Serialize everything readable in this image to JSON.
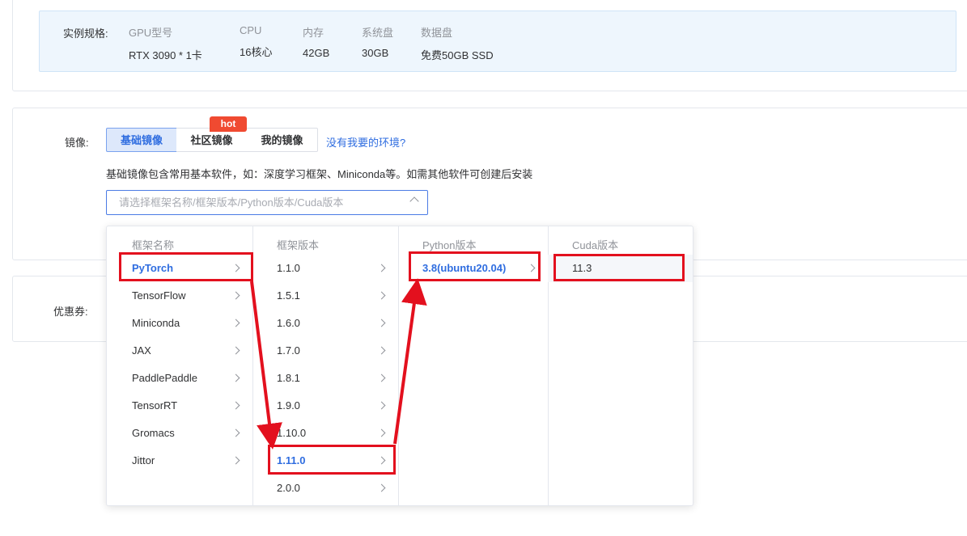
{
  "spec": {
    "label": "实例规格:",
    "columns": [
      {
        "header": "GPU型号",
        "value": "RTX 3090 * 1卡"
      },
      {
        "header": "CPU",
        "value": "16核心"
      },
      {
        "header": "内存",
        "value": "42GB"
      },
      {
        "header": "系统盘",
        "value": "30GB"
      },
      {
        "header": "数据盘",
        "value": "免费50GB SSD"
      }
    ]
  },
  "image": {
    "label": "镜像:",
    "tabs": [
      "基础镜像",
      "社区镜像",
      "我的镜像"
    ],
    "hot_badge": "hot",
    "help_link": "没有我要的环境?",
    "description": "基础镜像包含常用基本软件，如：深度学习框架、Miniconda等。如需其他软件可创建后安装",
    "select_placeholder": "请选择框架名称/框架版本/Python版本/Cuda版本"
  },
  "coupon": {
    "label": "优惠券:"
  },
  "cascader": {
    "frameworks": {
      "header": "框架名称",
      "items": [
        "PyTorch",
        "TensorFlow",
        "Miniconda",
        "JAX",
        "PaddlePaddle",
        "TensorRT",
        "Gromacs",
        "Jittor"
      ],
      "selected": "PyTorch"
    },
    "versions": {
      "header": "框架版本",
      "items": [
        "1.1.0",
        "1.5.1",
        "1.6.0",
        "1.7.0",
        "1.8.1",
        "1.9.0",
        "1.10.0",
        "1.11.0",
        "2.0.0"
      ],
      "selected": "1.11.0"
    },
    "python": {
      "header": "Python版本",
      "items": [
        "3.8(ubuntu20.04)"
      ],
      "selected": "3.8(ubuntu20.04)"
    },
    "cuda": {
      "header": "Cuda版本",
      "items": [
        "11.3"
      ],
      "selected": "11.3"
    }
  },
  "colors": {
    "accent": "#2f6de0",
    "annotation": "#e3101e",
    "hot": "#f04a31"
  }
}
